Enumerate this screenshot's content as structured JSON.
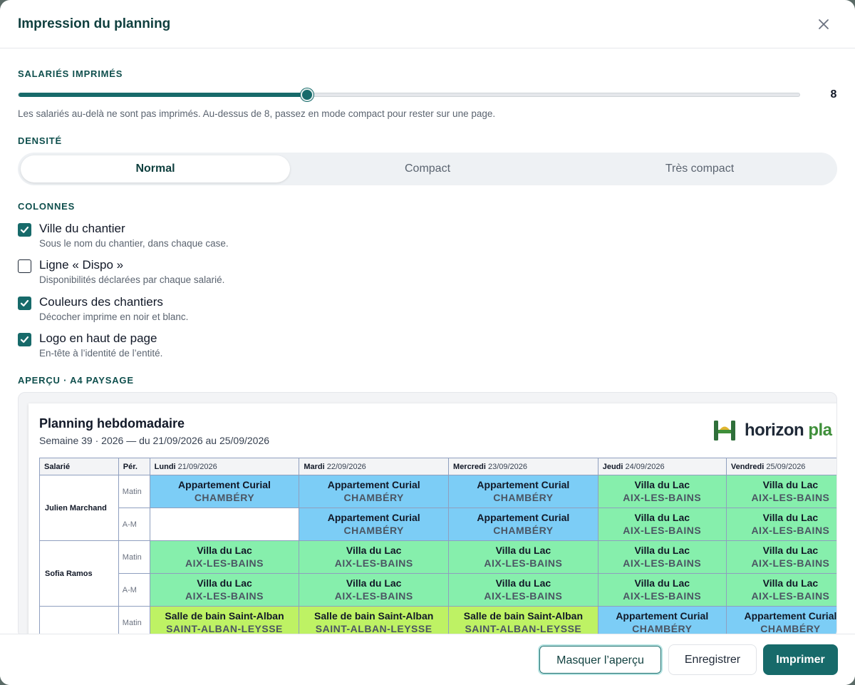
{
  "dialog": {
    "title": "Impression du planning",
    "close_icon": "close-icon"
  },
  "employees_printed": {
    "label": "SALARIÉS IMPRIMÉS",
    "value": "8",
    "level_fraction": 0.37,
    "helper": "Les salariés au-delà ne sont pas imprimés. Au-dessus de 8, passez en mode compact pour rester sur une page."
  },
  "density": {
    "label": "DENSITÉ",
    "options": [
      "Normal",
      "Compact",
      "Très compact"
    ],
    "selected": "Normal"
  },
  "columns": {
    "label": "COLONNES",
    "items": [
      {
        "label": "Ville du chantier",
        "desc": "Sous le nom du chantier, dans chaque case.",
        "checked": true
      },
      {
        "label": "Ligne « Dispo »",
        "desc": "Disponibilités déclarées par chaque salarié.",
        "checked": false
      },
      {
        "label": "Couleurs des chantiers",
        "desc": "Décocher imprime en noir et blanc.",
        "checked": true
      },
      {
        "label": "Logo en haut de page",
        "desc": "En-tête à l’identité de l’entité.",
        "checked": true
      }
    ]
  },
  "preview": {
    "label": "APERÇU · A4 PAYSAGE",
    "title": "Planning hebdomadaire",
    "subtitle": "Semaine 39 · 2026 — du 21/09/2026 au 25/09/2026",
    "logo": {
      "text_dark": "horizon ",
      "text_green": "pla",
      "icon": "horizon-logo-mark"
    },
    "headers": {
      "employee": "Salarié",
      "period": "Pér.",
      "days": [
        {
          "name": "Lundi",
          "date": "21/09/2026"
        },
        {
          "name": "Mardi",
          "date": "22/09/2026"
        },
        {
          "name": "Mercredi",
          "date": "23/09/2026"
        },
        {
          "name": "Jeudi",
          "date": "24/09/2026"
        },
        {
          "name": "Vendredi",
          "date": "25/09/2026"
        }
      ]
    },
    "colors": {
      "curial": "#7ccdf6",
      "lac": "#86efac",
      "alban": "#bef264",
      "empty": "#ffffff"
    },
    "rows": [
      {
        "employee": "Julien Marchand",
        "period": "Matin",
        "cells": [
          {
            "name": "Appartement Curial",
            "city": "CHAMBÉRY",
            "color": "curial"
          },
          {
            "name": "Appartement Curial",
            "city": "CHAMBÉRY",
            "color": "curial"
          },
          {
            "name": "Appartement Curial",
            "city": "CHAMBÉRY",
            "color": "curial"
          },
          {
            "name": "Villa du Lac",
            "city": "AIX-LES-BAINS",
            "color": "lac"
          },
          {
            "name": "Villa du Lac",
            "city": "AIX-LES-BAINS",
            "color": "lac"
          }
        ]
      },
      {
        "employee": "",
        "period": "A-M",
        "cells": [
          {
            "name": "",
            "city": "",
            "color": "empty"
          },
          {
            "name": "Appartement Curial",
            "city": "CHAMBÉRY",
            "color": "curial"
          },
          {
            "name": "Appartement Curial",
            "city": "CHAMBÉRY",
            "color": "curial"
          },
          {
            "name": "Villa du Lac",
            "city": "AIX-LES-BAINS",
            "color": "lac"
          },
          {
            "name": "Villa du Lac",
            "city": "AIX-LES-BAINS",
            "color": "lac"
          }
        ]
      },
      {
        "employee": "Sofia Ramos",
        "period": "Matin",
        "cells": [
          {
            "name": "Villa du Lac",
            "city": "AIX-LES-BAINS",
            "color": "lac"
          },
          {
            "name": "Villa du Lac",
            "city": "AIX-LES-BAINS",
            "color": "lac"
          },
          {
            "name": "Villa du Lac",
            "city": "AIX-LES-BAINS",
            "color": "lac"
          },
          {
            "name": "Villa du Lac",
            "city": "AIX-LES-BAINS",
            "color": "lac"
          },
          {
            "name": "Villa du Lac",
            "city": "AIX-LES-BAINS",
            "color": "lac"
          }
        ]
      },
      {
        "employee": "",
        "period": "A-M",
        "cells": [
          {
            "name": "Villa du Lac",
            "city": "AIX-LES-BAINS",
            "color": "lac"
          },
          {
            "name": "Villa du Lac",
            "city": "AIX-LES-BAINS",
            "color": "lac"
          },
          {
            "name": "Villa du Lac",
            "city": "AIX-LES-BAINS",
            "color": "lac"
          },
          {
            "name": "Villa du Lac",
            "city": "AIX-LES-BAINS",
            "color": "lac"
          },
          {
            "name": "Villa du Lac",
            "city": "AIX-LES-BAINS",
            "color": "lac"
          }
        ]
      },
      {
        "employee": "",
        "period": "Matin",
        "cells": [
          {
            "name": "Salle de bain Saint-Alban",
            "city": "SAINT-ALBAN-LEYSSE",
            "color": "alban"
          },
          {
            "name": "Salle de bain Saint-Alban",
            "city": "SAINT-ALBAN-LEYSSE",
            "color": "alban"
          },
          {
            "name": "Salle de bain Saint-Alban",
            "city": "SAINT-ALBAN-LEYSSE",
            "color": "alban"
          },
          {
            "name": "Appartement Curial",
            "city": "CHAMBÉRY",
            "color": "curial"
          },
          {
            "name": "Appartement Curial",
            "city": "CHAMBÉRY",
            "color": "curial"
          }
        ]
      }
    ]
  },
  "footer": {
    "hide_preview": "Masquer l’aperçu",
    "save": "Enregistrer",
    "print": "Imprimer"
  }
}
